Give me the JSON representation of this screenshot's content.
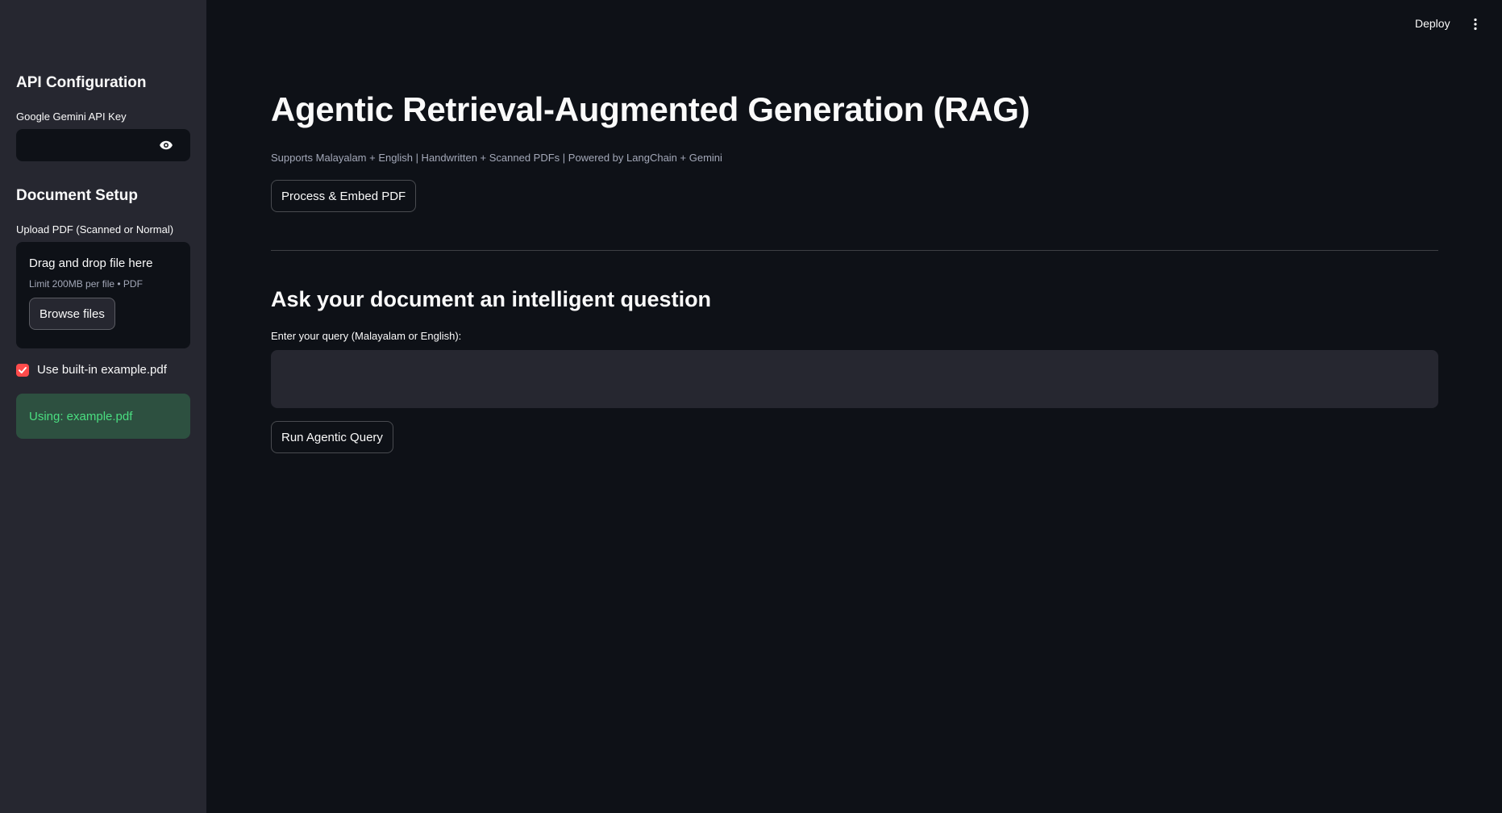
{
  "header": {
    "deploy_label": "Deploy"
  },
  "sidebar": {
    "api_title": "API Configuration",
    "api_key_label": "Google Gemini API Key",
    "api_key_value": "",
    "doc_title": "Document Setup",
    "upload_label": "Upload PDF (Scanned or Normal)",
    "dropzone_title": "Drag and drop file here",
    "dropzone_limit": "Limit 200MB per file • PDF",
    "browse_label": "Browse files",
    "checkbox_label": "Use built-in example.pdf",
    "checkbox_checked": true,
    "success_text": "Using: example.pdf"
  },
  "main": {
    "title": "Agentic Retrieval-Augmented Generation (RAG)",
    "caption": "Supports Malayalam + English | Handwritten + Scanned PDFs | Powered by LangChain + Gemini",
    "process_button": "Process & Embed PDF",
    "section_title": "Ask your document an intelligent question",
    "query_label": "Enter your query (Malayalam or English):",
    "query_value": "",
    "run_button": "Run Agentic Query"
  },
  "colors": {
    "background": "#0e1117",
    "sidebar": "#262730",
    "accent": "#ff4b4b",
    "success_text": "#4ade80"
  },
  "icons": {
    "password_toggle": "eye-icon",
    "menu": "kebab-menu-icon",
    "checkbox": "checkmark-icon"
  }
}
